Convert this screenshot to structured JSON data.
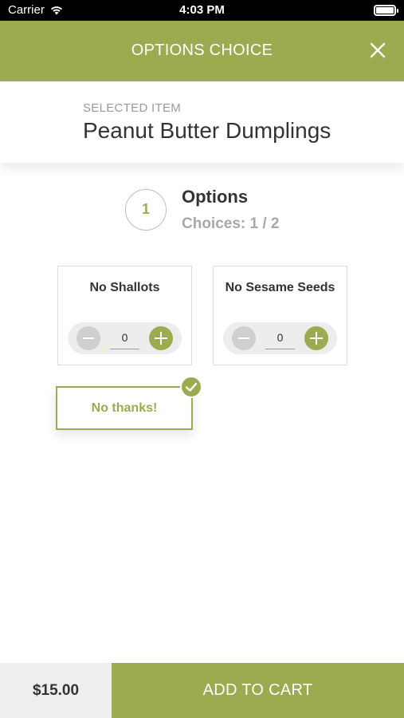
{
  "status_bar": {
    "carrier": "Carrier",
    "time": "4:03 PM"
  },
  "header": {
    "title": "OPTIONS CHOICE",
    "close_icon": "close-icon"
  },
  "selected": {
    "caption": "SELECTED ITEM",
    "item_name": "Peanut Butter Dumplings"
  },
  "options": {
    "step_number": "1",
    "title": "Options",
    "choices_text": "Choices: 1 / 2",
    "cards": [
      {
        "label": "No Shallots",
        "quantity": "0"
      },
      {
        "label": "No Sesame Seeds",
        "quantity": "0"
      }
    ],
    "no_thanks": {
      "label": "No thanks!",
      "selected": true
    }
  },
  "footer": {
    "price": "$15.00",
    "add_to_cart": "ADD TO CART"
  },
  "colors": {
    "accent": "#9bab4f",
    "status_bar": "#000000",
    "price_bg": "#eeeeee"
  }
}
